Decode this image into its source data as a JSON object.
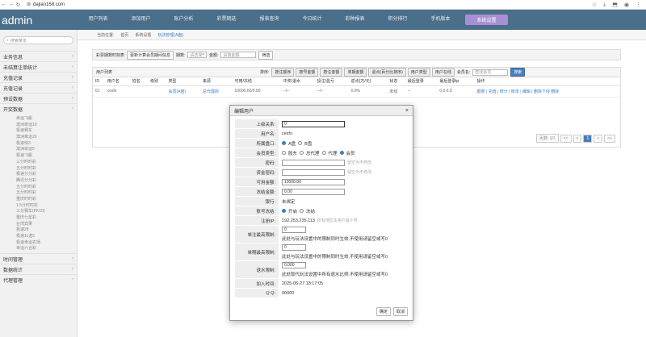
{
  "browser": {
    "url": "dajian168.com"
  },
  "app": {
    "title": "admin"
  },
  "topnav": [
    "用户列表",
    "添加用户",
    "账户分析",
    "彩票期选",
    "报表查询",
    "今日统计",
    "彩种报表",
    "积分排行",
    "手机版本",
    "系统设置"
  ],
  "sidebar": {
    "search_placeholder": "搜索菜单",
    "groups_top": [
      "业务信息",
      "未结算注单统计",
      "充值记录",
      "充值记录",
      "预设数据",
      "开奖数据"
    ],
    "subitems": [
      "幸运飞艇",
      "澳洲幸运10",
      "极速赛车",
      "澳洲幸运20",
      "极速快3",
      "澳洲幸运5",
      "极速飞艇",
      "三分时时彩",
      "五分时时彩",
      "极速分分彩",
      "腾讯分分彩",
      "五分时时彩",
      "五分时时彩",
      "重庆时时彩",
      "1.5分时时彩",
      "三分赛车(PK10)",
      "重庆七星彩",
      "台湾宾果",
      "极速28",
      "极速11选5",
      "极速幸运农场",
      "幸运六合彩"
    ],
    "groups_bottom": [
      "时间管理",
      "数据统计",
      "代理管理"
    ]
  },
  "breadcrumb": {
    "pos_label": "当前位置:",
    "home": "首页",
    "mid": "系统设置",
    "active": "玩法管理(A盘)"
  },
  "filterbar": {
    "label": "彩票期数时刻表",
    "btn1": "更新计算会员期间信息",
    "sel_label": "期数:",
    "sel_value": "请选择",
    "amount_label": "金额:",
    "amount_placeholder": "请填金额",
    "go": "筛选"
  },
  "panel": {
    "title": "用户列表",
    "sort_label": "排序:",
    "buttons": [
      "按注额序",
      "按号金额",
      "按注金额",
      "单期金额",
      "退点(百分比排序)",
      "用户类型",
      "用户在线"
    ],
    "member_label": "会员名:",
    "member_placeholder": "查找会员",
    "search_btn": "搜索",
    "headers": [
      "ID",
      "用户名",
      "姓名",
      "级别",
      "类型",
      "来源",
      "可用/冻结",
      "中奖/退水",
      "投注/盈亏",
      "返点(万/元)",
      "状态",
      "最后登录",
      "最后登录ip",
      "操作"
    ],
    "row": [
      "61",
      "ceshi",
      "",
      "",
      "会员(A盘)",
      "总代理商",
      "10000.00/0.00",
      "--/--",
      "--/--",
      "0.0%",
      "未线",
      "--",
      "0.0.0.0",
      "额度 | 充值 | 统计 | 帐单 | 编辑 | 删除下线 删除"
    ],
    "pager": {
      "info": "页数: 1/1",
      "first": "<<",
      "prev": "<",
      "page": "1",
      "next": ">",
      "last": ">>"
    }
  },
  "modal": {
    "title": "编辑用户",
    "close": "×",
    "superior_label": "上级关系:",
    "superior_value": "0",
    "username_label": "用户名:",
    "username_value": "ceshi",
    "market_label": "所属盘口:",
    "market_a": "A盘",
    "market_b": "B盘",
    "type_label": "会员类型:",
    "type_opts": [
      "股东",
      "总代理",
      "代理",
      "会员"
    ],
    "pwd_label": "密码:",
    "pwd_hint": "留空为不修改",
    "fund_pwd_label": "资金密码:",
    "fund_pwd_hint": "留空为不修改",
    "avail_label": "可用金额:",
    "avail_value": "10000.00",
    "frozen_label": "冻结金额:",
    "frozen_value": "0.00",
    "bank_label": "银行:",
    "bank_value": "未绑定",
    "status_label": "账号冻结:",
    "status_on": "开启",
    "status_off": "冻结",
    "ip_label": "注册IP:",
    "ip_value": "192.253.235.113",
    "ip_note": "所有地区本用户最小号",
    "single_min_label": "单注最高限制:",
    "single_min_value": "0",
    "single_min_note": "此处与玩法设置中的限制同时生效,不使用请留空或写0",
    "period_max_label": "单期最高限制:",
    "period_max_value": "0",
    "period_max_note": "此处与玩法设置中的限制同时生效,不使用请留空或写0",
    "rebate_label": "退水限制:",
    "rebate_value": "0.000",
    "rebate_note": "此处取代玩法设置中所有退水比例,不使用请留空或写0",
    "join_label": "加入时间:",
    "join_value": "2025-05-27 18:17:05",
    "qq_label": "Q Q:",
    "qq_value": "00000",
    "ok": "确定",
    "cancel": "取消"
  }
}
